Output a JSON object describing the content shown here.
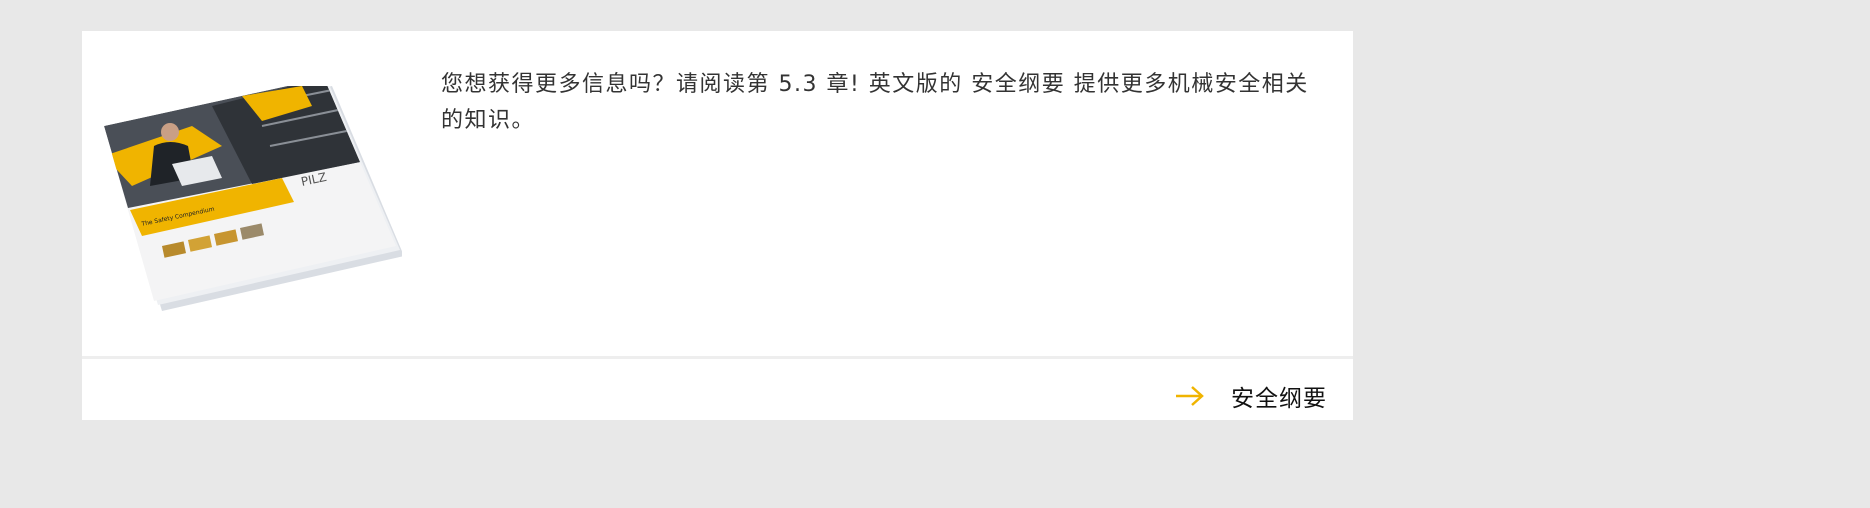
{
  "teaser": {
    "description": "您想获得更多信息吗？请阅读第 5.3 章! 英文版的 安全纲要 提供更多机械安全相关的知识。",
    "image_text": {
      "cover_brand": "PILZ",
      "cover_title": "The Safety Compendium"
    },
    "link_label": "安全纲要",
    "link_icon": "arrow-right-icon",
    "accent_color": "#f0b400"
  }
}
